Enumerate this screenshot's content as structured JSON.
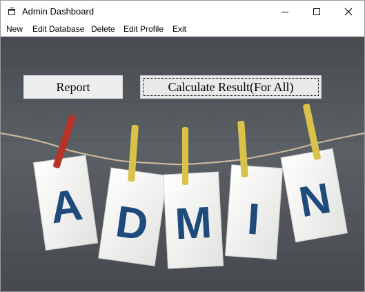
{
  "window": {
    "title": "Admin Dashboard",
    "icon": "window-app-icon",
    "controls": [
      "minimize-icon",
      "maximize-icon",
      "close-icon"
    ]
  },
  "menu": [
    "New",
    "Edit Database",
    "Delete",
    "Edit Profile",
    "Exit"
  ],
  "buttons": {
    "report": "Report",
    "calculate": "Calculate Result(For All)"
  },
  "background_image": {
    "cards": [
      "A",
      "D",
      "M",
      "I",
      "N"
    ],
    "colors": {
      "board": "#53585d",
      "card": "#f4f4f2",
      "letter": "#1f4a7c",
      "pin_yellow": "#d9c14a",
      "pin_red": "#b8322a",
      "string": "#c8b79a"
    }
  }
}
